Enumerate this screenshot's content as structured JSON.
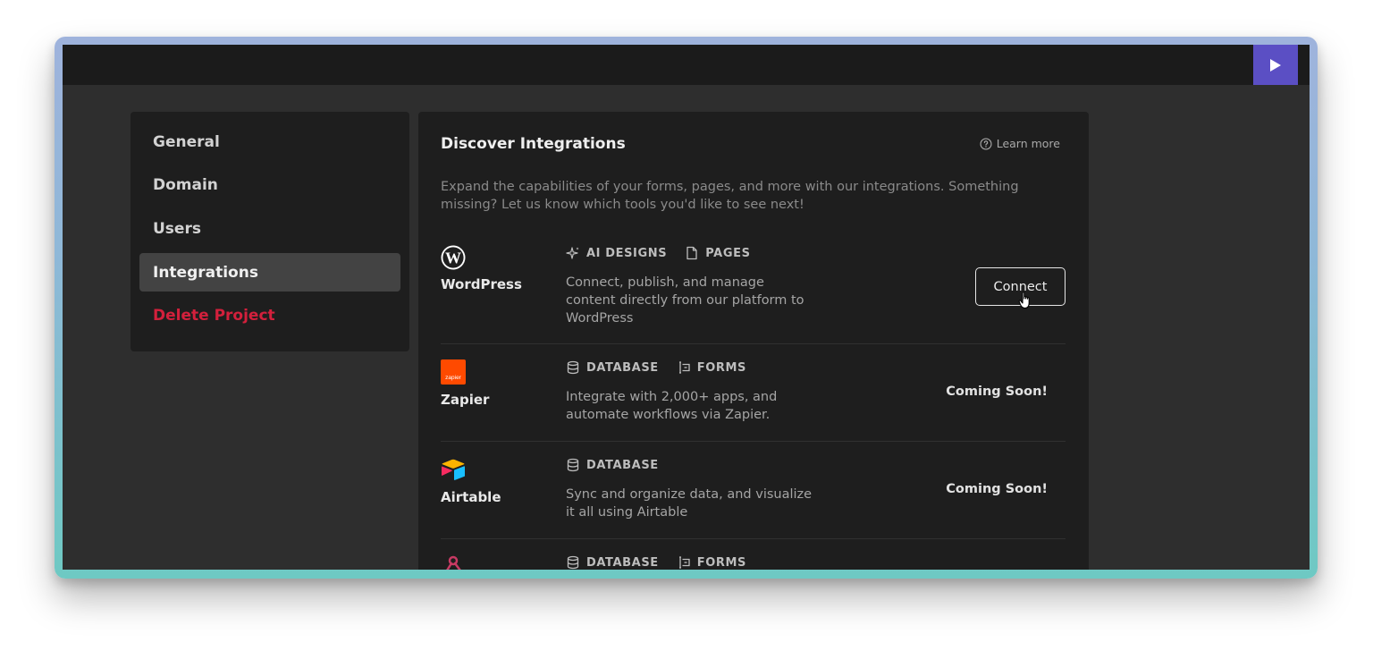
{
  "sidebar": {
    "items": [
      {
        "label": "General"
      },
      {
        "label": "Domain"
      },
      {
        "label": "Users"
      },
      {
        "label": "Integrations"
      },
      {
        "label": "Delete Project"
      }
    ]
  },
  "panel": {
    "title": "Discover Integrations",
    "learn_more": "Learn more",
    "description": "Expand the capabilities of your forms, pages, and more with our integrations. Something missing? Let us know which tools you'd like to see next!"
  },
  "integrations": [
    {
      "name": "WordPress",
      "icon": "wordpress-icon",
      "tags": [
        "AI DESIGNS",
        "PAGES"
      ],
      "description": "Connect, publish, and manage content directly from our platform to WordPress",
      "action": "Connect"
    },
    {
      "name": "Zapier",
      "icon": "zapier-icon",
      "logo_text": "zapier",
      "tags": [
        "DATABASE",
        "FORMS"
      ],
      "description": "Integrate with 2,000+ apps, and automate workflows via Zapier.",
      "action": "Coming Soon!"
    },
    {
      "name": "Airtable",
      "icon": "airtable-icon",
      "tags": [
        "DATABASE"
      ],
      "description": "Sync and organize data, and visualize it all using Airtable",
      "action": "Coming Soon!"
    },
    {
      "icon": "webhook-icon",
      "tags": [
        "DATABASE",
        "FORMS"
      ]
    }
  ],
  "colors": {
    "accent": "#5b4fc4",
    "danger": "#d3203c",
    "zapier": "#ff4a00"
  }
}
